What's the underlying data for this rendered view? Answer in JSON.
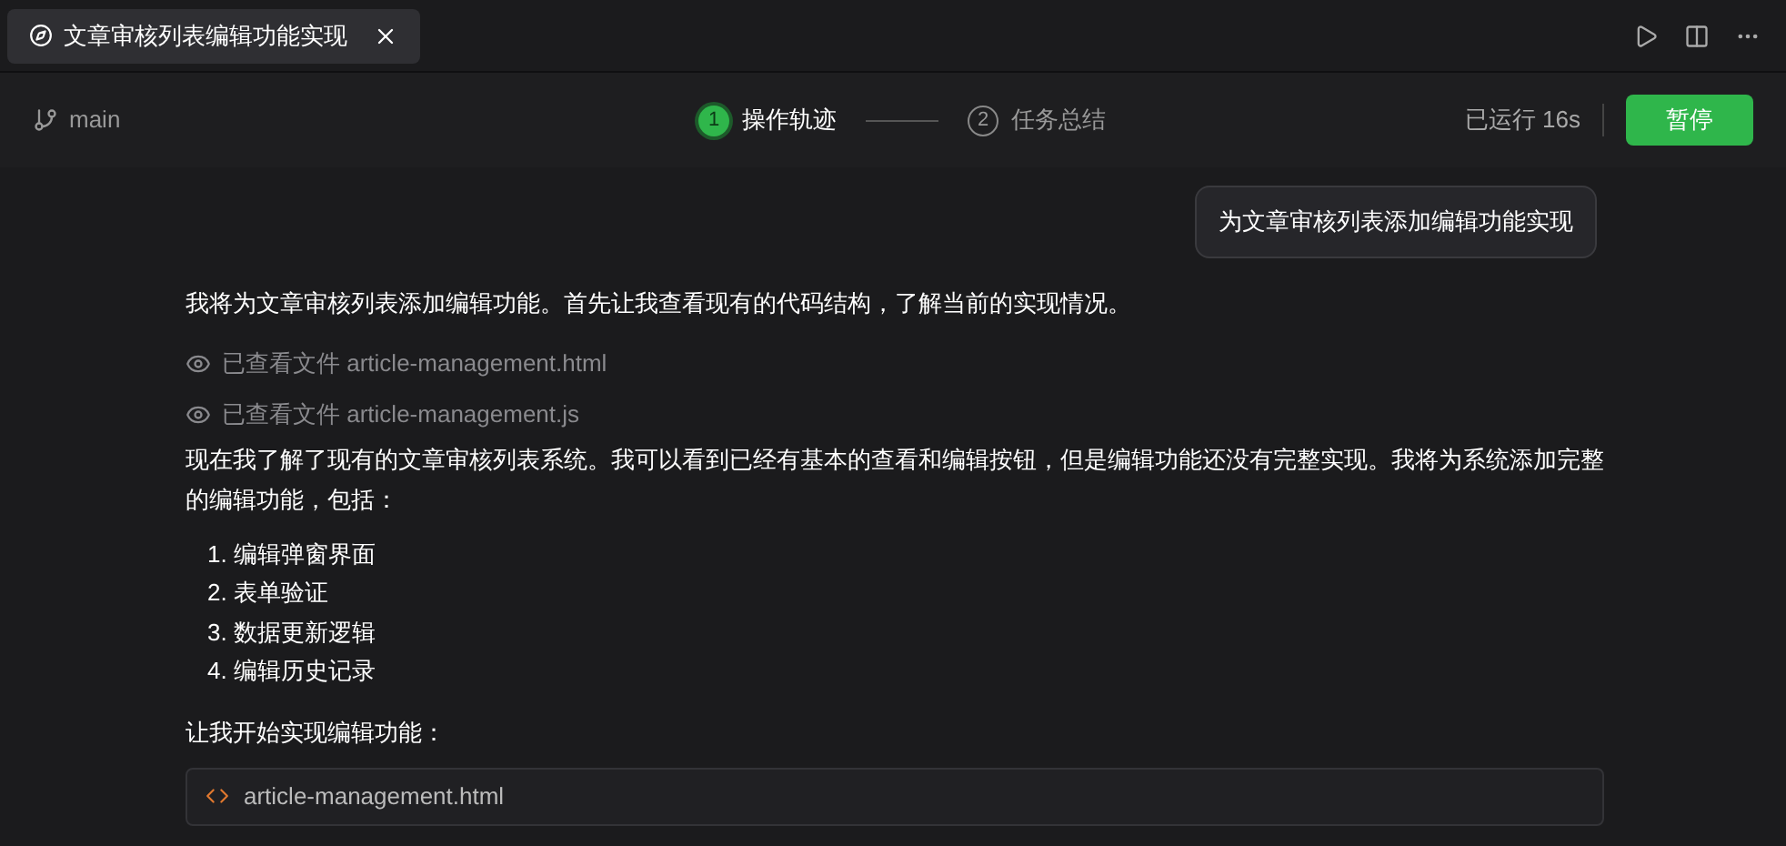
{
  "tab": {
    "title": "文章审核列表编辑功能实现",
    "selected": true
  },
  "branch": "main",
  "steps": [
    {
      "number": "1",
      "label": "操作轨迹",
      "selected": true
    },
    {
      "number": "2",
      "label": "任务总结",
      "selected": false
    }
  ],
  "elapsed": "已运行 16s",
  "pause_button": "暂停",
  "user_message": "为文章审核列表添加编辑功能实现",
  "messages": [
    {
      "kind": "paragraph",
      "text": "我将为文章审核列表添加编辑功能。首先让我查看现有的代码结构，了解当前的实现情况。"
    },
    {
      "kind": "viewed",
      "action": "已查看文件",
      "file": "article-management.html"
    },
    {
      "kind": "viewed",
      "action": "已查看文件",
      "file": "article-management.js"
    },
    {
      "kind": "paragraph",
      "text": "现在我了解了现有的文章审核列表系统。我可以看到已经有基本的查看和编辑按钮，但是编辑功能还没有完整实现。我将为系统添加完整的编辑功能，包括："
    },
    {
      "kind": "list",
      "items": [
        "1. 编辑弹窗界面",
        "2. 表单验证",
        "3. 数据更新逻辑",
        "4. 编辑历史记录"
      ]
    },
    {
      "kind": "paragraph",
      "text": "让我开始实现编辑功能："
    },
    {
      "kind": "file",
      "file": "article-management.html"
    }
  ]
}
